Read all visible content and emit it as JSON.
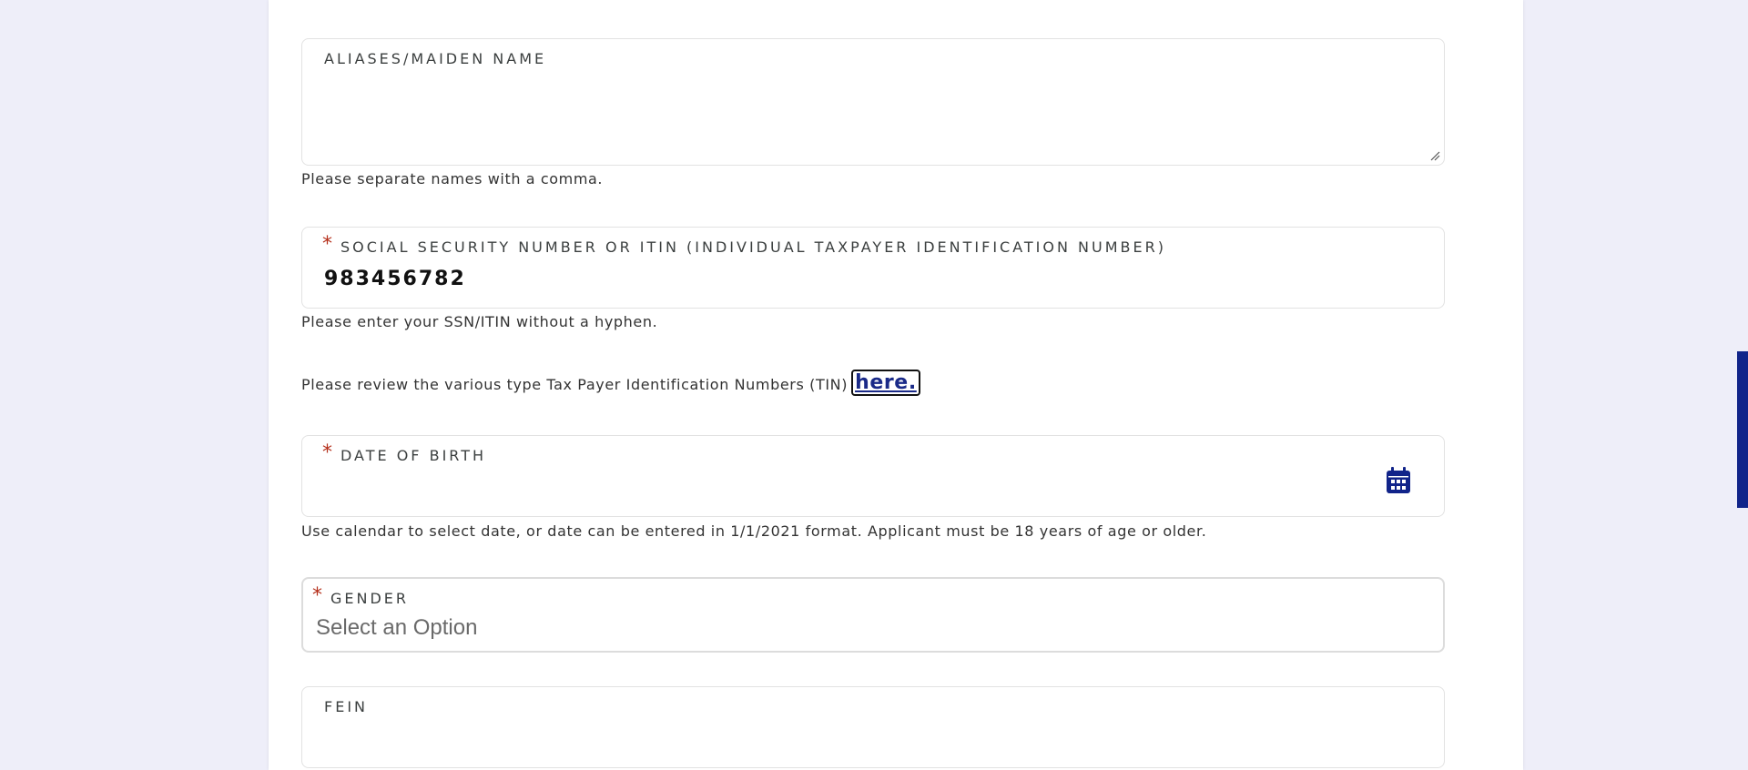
{
  "form": {
    "aliases": {
      "label": "ALIASES/MAIDEN NAME",
      "value": "",
      "help": "Please separate names with a comma."
    },
    "ssn": {
      "label": "SOCIAL SECURITY NUMBER OR ITIN (INDIVIDUAL TAXPAYER IDENTIFICATION NUMBER)",
      "value": "983456782",
      "help": "Please enter your SSN/ITIN without a hyphen."
    },
    "tin_note": {
      "text": "Please review the various type Tax Payer Identification Numbers (TIN)",
      "link": "here."
    },
    "dob": {
      "label": "DATE OF BIRTH",
      "value": "",
      "help": "Use calendar to select date, or date can be entered in 1/1/2021 format. Applicant must be 18 years of age or older."
    },
    "gender": {
      "label": "GENDER",
      "selected": "Select an Option"
    },
    "fein": {
      "label": "FEIN",
      "value": ""
    },
    "required_marker": "*"
  },
  "icons": {
    "calendar": "calendar-icon",
    "resize": "resize-grip-icon"
  },
  "colors": {
    "background": "#eeeef9",
    "required": "#b5301c",
    "link": "#1a2a88",
    "accent": "#11248a"
  }
}
